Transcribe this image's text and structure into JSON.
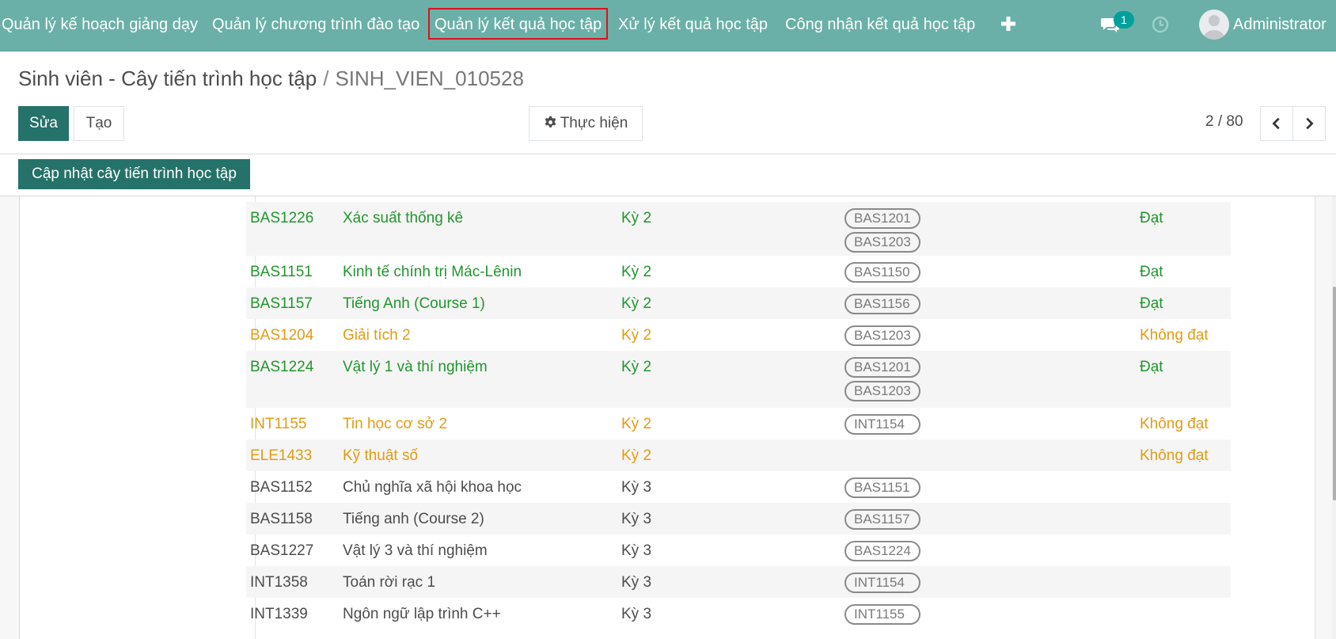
{
  "navbar": {
    "menu": [
      "Quản lý kế hoạch giảng dạy",
      "Quản lý chương trình đào tạo",
      "Quản lý kết quả học tập",
      "Xử lý kết quả học tập",
      "Công nhận kết quả học tập"
    ],
    "messages_count": "1",
    "user_name": "Administrator"
  },
  "breadcrumb": {
    "parent": "Sinh viên - Cây tiến trình học tập",
    "separator": "/",
    "current": "SINH_VIEN_010528"
  },
  "toolbar": {
    "edit_label": "Sửa",
    "create_label": "Tạo",
    "action_label": "Thực hiện",
    "pager": "2 / 80"
  },
  "statusbar": {
    "update_label": "Cập nhật cây tiến trình học tập"
  },
  "colors": {
    "navbar": "#6ab0a8",
    "primary": "#25726a",
    "passed": "#21962d",
    "failed": "#e39b12",
    "active_menu_border": "#e0101c"
  },
  "courses": [
    {
      "code": "BAS1226",
      "name": "Xác suất thống kê",
      "term": "Kỳ 2",
      "prereqs": [
        "BAS1201",
        "BAS1203"
      ],
      "result": "Đạt",
      "status": "green"
    },
    {
      "code": "BAS1151",
      "name": "Kinh tế chính trị Mác-Lênin",
      "term": "Kỳ 2",
      "prereqs": [
        "BAS1150"
      ],
      "result": "Đạt",
      "status": "green"
    },
    {
      "code": "BAS1157",
      "name": "Tiếng Anh (Course 1)",
      "term": "Kỳ 2",
      "prereqs": [
        "BAS1156"
      ],
      "result": "Đạt",
      "status": "green"
    },
    {
      "code": "BAS1204",
      "name": "Giải tích 2",
      "term": "Kỳ 2",
      "prereqs": [
        "BAS1203"
      ],
      "result": "Không đạt",
      "status": "orange"
    },
    {
      "code": "BAS1224",
      "name": "Vật lý 1 và thí nghiệm",
      "term": "Kỳ 2",
      "prereqs": [
        "BAS1201",
        "BAS1203"
      ],
      "result": "Đạt",
      "status": "green"
    },
    {
      "code": "INT1155",
      "name": "Tin học cơ sở 2",
      "term": "Kỳ 2",
      "prereqs": [
        "INT1154"
      ],
      "result": "Không đạt",
      "status": "orange"
    },
    {
      "code": "ELE1433",
      "name": "Kỹ thuật số",
      "term": "Kỳ 2",
      "prereqs": [],
      "result": "Không đạt",
      "status": "orange"
    },
    {
      "code": "BAS1152",
      "name": "Chủ nghĩa xã hội khoa học",
      "term": "Kỳ 3",
      "prereqs": [
        "BAS1151"
      ],
      "result": "",
      "status": "normal"
    },
    {
      "code": "BAS1158",
      "name": "Tiếng anh (Course 2)",
      "term": "Kỳ 3",
      "prereqs": [
        "BAS1157"
      ],
      "result": "",
      "status": "normal"
    },
    {
      "code": "BAS1227",
      "name": "Vật lý 3 và thí nghiệm",
      "term": "Kỳ 3",
      "prereqs": [
        "BAS1224"
      ],
      "result": "",
      "status": "normal"
    },
    {
      "code": "INT1358",
      "name": "Toán rời rạc 1",
      "term": "Kỳ 3",
      "prereqs": [
        "INT1154"
      ],
      "result": "",
      "status": "normal"
    },
    {
      "code": "INT1339",
      "name": "Ngôn ngữ lập trình C++",
      "term": "Kỳ 3",
      "prereqs": [
        "INT1155"
      ],
      "result": "",
      "status": "normal"
    }
  ]
}
